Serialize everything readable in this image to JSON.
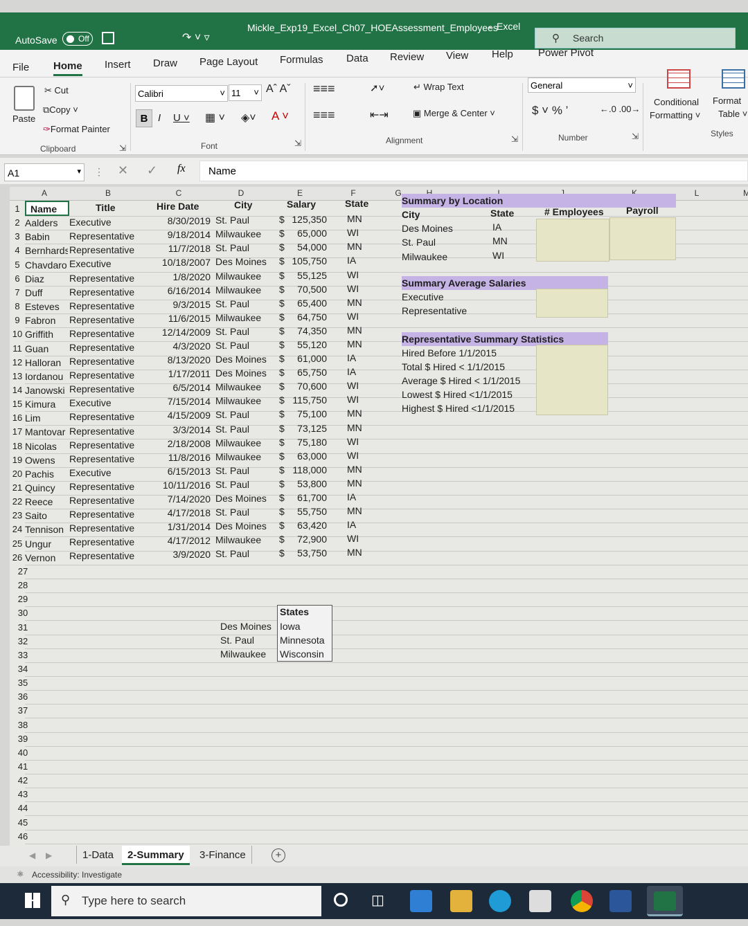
{
  "app": {
    "autosave_label": "AutoSave",
    "autosave_state": "Off",
    "file_title": "Mickle_Exp19_Excel_Ch07_HOEAssessment_Employees",
    "app_name": "Excel",
    "search_placeholder": "Search"
  },
  "ribbon_tabs": [
    "File",
    "Home",
    "Insert",
    "Draw",
    "Page Layout",
    "Formulas",
    "Data",
    "Review",
    "View",
    "Help",
    "Power Pivot"
  ],
  "ribbon": {
    "paste": "Paste",
    "cut": "Cut",
    "copy": "Copy",
    "format_painter": "Format Painter",
    "clipboard": "Clipboard",
    "font_name": "Calibri",
    "font_size": "11",
    "font_group": "Font",
    "wrap_text": "Wrap Text",
    "merge_center": "Merge & Center",
    "alignment": "Alignment",
    "number_format": "General",
    "number_group": "Number",
    "conditional": "Conditional",
    "formatting": "Formatting",
    "format_as": "Format",
    "table": "Table",
    "styles": "Styles"
  },
  "formula_bar": {
    "name_box": "A1",
    "fx": "fx",
    "content": "Name"
  },
  "columns": [
    "A",
    "B",
    "C",
    "D",
    "E",
    "F",
    "G",
    "H",
    "I",
    "J",
    "K",
    "L",
    "M"
  ],
  "headers": {
    "name": "Name",
    "title": "Title",
    "hire": "Hire Date",
    "city": "City",
    "salary": "Salary",
    "state": "State"
  },
  "rows": [
    {
      "n": "2",
      "name": "Aalders",
      "title": "Executive",
      "hire": "8/30/2019",
      "city": "St. Paul",
      "salary": "125,350",
      "state": "MN"
    },
    {
      "n": "3",
      "name": "Babin",
      "title": "Representative",
      "hire": "9/18/2014",
      "city": "Milwaukee",
      "salary": "65,000",
      "state": "WI"
    },
    {
      "n": "4",
      "name": "Bernhards",
      "title": "Representative",
      "hire": "11/7/2018",
      "city": "St. Paul",
      "salary": "54,000",
      "state": "MN"
    },
    {
      "n": "5",
      "name": "Chavdaro",
      "title": "Executive",
      "hire": "10/18/2007",
      "city": "Des Moines",
      "salary": "105,750",
      "state": "IA"
    },
    {
      "n": "6",
      "name": "Diaz",
      "title": "Representative",
      "hire": "1/8/2020",
      "city": "Milwaukee",
      "salary": "55,125",
      "state": "WI"
    },
    {
      "n": "7",
      "name": "Duff",
      "title": "Representative",
      "hire": "6/16/2014",
      "city": "Milwaukee",
      "salary": "70,500",
      "state": "WI"
    },
    {
      "n": "8",
      "name": "Esteves",
      "title": "Representative",
      "hire": "9/3/2015",
      "city": "St. Paul",
      "salary": "65,400",
      "state": "MN"
    },
    {
      "n": "9",
      "name": "Fabron",
      "title": "Representative",
      "hire": "11/6/2015",
      "city": "Milwaukee",
      "salary": "64,750",
      "state": "WI"
    },
    {
      "n": "10",
      "name": "Griffith",
      "title": "Representative",
      "hire": "12/14/2009",
      "city": "St. Paul",
      "salary": "74,350",
      "state": "MN"
    },
    {
      "n": "11",
      "name": "Guan",
      "title": "Representative",
      "hire": "4/3/2020",
      "city": "St. Paul",
      "salary": "55,120",
      "state": "MN"
    },
    {
      "n": "12",
      "name": "Halloran",
      "title": "Representative",
      "hire": "8/13/2020",
      "city": "Des Moines",
      "salary": "61,000",
      "state": "IA"
    },
    {
      "n": "13",
      "name": "Iordanou",
      "title": "Representative",
      "hire": "1/17/2011",
      "city": "Des Moines",
      "salary": "65,750",
      "state": "IA"
    },
    {
      "n": "14",
      "name": "Janowski",
      "title": "Representative",
      "hire": "6/5/2014",
      "city": "Milwaukee",
      "salary": "70,600",
      "state": "WI"
    },
    {
      "n": "15",
      "name": "Kimura",
      "title": "Executive",
      "hire": "7/15/2014",
      "city": "Milwaukee",
      "salary": "115,750",
      "state": "WI"
    },
    {
      "n": "16",
      "name": "Lim",
      "title": "Representative",
      "hire": "4/15/2009",
      "city": "St. Paul",
      "salary": "75,100",
      "state": "MN"
    },
    {
      "n": "17",
      "name": "Mantovar",
      "title": "Representative",
      "hire": "3/3/2014",
      "city": "St. Paul",
      "salary": "73,125",
      "state": "MN"
    },
    {
      "n": "18",
      "name": "Nicolas",
      "title": "Representative",
      "hire": "2/18/2008",
      "city": "Milwaukee",
      "salary": "75,180",
      "state": "WI"
    },
    {
      "n": "19",
      "name": "Owens",
      "title": "Representative",
      "hire": "11/8/2016",
      "city": "Milwaukee",
      "salary": "63,000",
      "state": "WI"
    },
    {
      "n": "20",
      "name": "Pachis",
      "title": "Executive",
      "hire": "6/15/2013",
      "city": "St. Paul",
      "salary": "118,000",
      "state": "MN"
    },
    {
      "n": "21",
      "name": "Quincy",
      "title": "Representative",
      "hire": "10/11/2016",
      "city": "St. Paul",
      "salary": "53,800",
      "state": "MN"
    },
    {
      "n": "22",
      "name": "Reece",
      "title": "Representative",
      "hire": "7/14/2020",
      "city": "Des Moines",
      "salary": "61,700",
      "state": "IA"
    },
    {
      "n": "23",
      "name": "Saito",
      "title": "Representative",
      "hire": "4/17/2018",
      "city": "St. Paul",
      "salary": "55,750",
      "state": "MN"
    },
    {
      "n": "24",
      "name": "Tennison",
      "title": "Representative",
      "hire": "1/31/2014",
      "city": "Des Moines",
      "salary": "63,420",
      "state": "IA"
    },
    {
      "n": "25",
      "name": "Ungur",
      "title": "Representative",
      "hire": "4/17/2012",
      "city": "Milwaukee",
      "salary": "72,900",
      "state": "WI"
    },
    {
      "n": "26",
      "name": "Vernon",
      "title": "Representative",
      "hire": "3/9/2020",
      "city": "St. Paul",
      "salary": "53,750",
      "state": "MN"
    }
  ],
  "dollar": "$",
  "summary_location": {
    "title": "Summary by Location",
    "city_hdr": "City",
    "state_hdr": "State",
    "emp_hdr": "# Employees",
    "payroll_hdr": "Payroll",
    "rows": [
      {
        "city": "Des Moines",
        "state": "IA"
      },
      {
        "city": "St. Paul",
        "state": "MN"
      },
      {
        "city": "Milwaukee",
        "state": "WI"
      }
    ]
  },
  "summary_avg": {
    "title": "Summary Average Salaries",
    "rows": [
      "Executive",
      "Representative"
    ]
  },
  "rep_stats": {
    "title": "Representative Summary Statistics",
    "rows": [
      "Hired Before 1/1/2015",
      "Total $ Hired < 1/1/2015",
      "Average $ Hired < 1/1/2015",
      "Lowest $ Hired <1/1/2015",
      "Highest $ Hired <1/1/2015"
    ]
  },
  "states_table": {
    "header": "States",
    "rows": [
      {
        "city": "Des Moines",
        "state": "Iowa"
      },
      {
        "city": "St. Paul",
        "state": "Minnesota"
      },
      {
        "city": "Milwaukee",
        "state": "Wisconsin"
      }
    ]
  },
  "sheet_tabs": [
    "1-Data",
    "2-Summary",
    "3-Finance"
  ],
  "status_text": "Accessibility: Investigate",
  "taskbar_search": "Type here to search"
}
